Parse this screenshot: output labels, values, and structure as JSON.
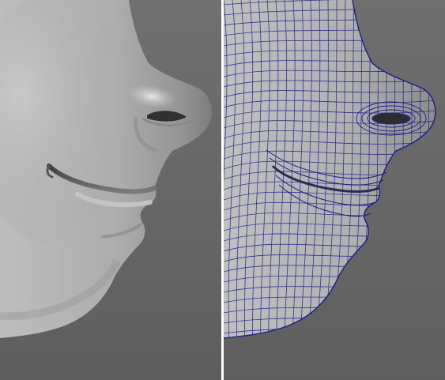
{
  "viewports": {
    "left": {
      "shading": "smooth"
    },
    "right": {
      "shading": "wireframe-on-shaded"
    }
  },
  "colors": {
    "background": "#6c6c6c",
    "surface": "#b9b9b9",
    "wire": "#1a1f86",
    "divider": "#ffffff"
  }
}
